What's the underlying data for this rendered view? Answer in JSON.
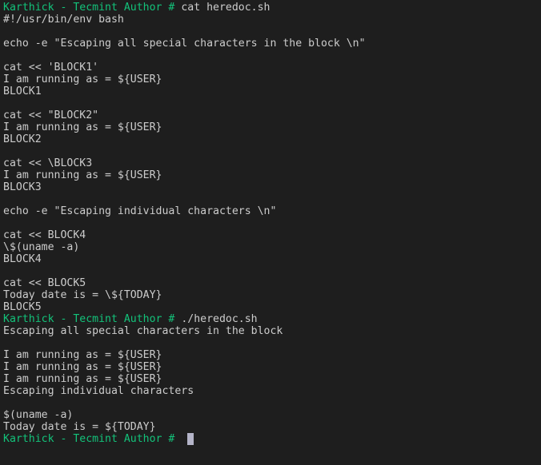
{
  "terminal": {
    "prompt": "Karthick - Tecmint Author #",
    "colors": {
      "background": "#1e1e1e",
      "text": "#cccccc",
      "prompt": "#13c27a",
      "cursor": "#b4b4c8"
    },
    "session": [
      {
        "type": "prompt",
        "command": " cat heredoc.sh"
      },
      {
        "type": "output",
        "text": "#!/usr/bin/env bash"
      },
      {
        "type": "output",
        "text": ""
      },
      {
        "type": "output",
        "text": "echo -e \"Escaping all special characters in the block \\n\""
      },
      {
        "type": "output",
        "text": ""
      },
      {
        "type": "output",
        "text": "cat << 'BLOCK1'"
      },
      {
        "type": "output",
        "text": "I am running as = ${USER}"
      },
      {
        "type": "output",
        "text": "BLOCK1"
      },
      {
        "type": "output",
        "text": ""
      },
      {
        "type": "output",
        "text": "cat << \"BLOCK2\""
      },
      {
        "type": "output",
        "text": "I am running as = ${USER}"
      },
      {
        "type": "output",
        "text": "BLOCK2"
      },
      {
        "type": "output",
        "text": ""
      },
      {
        "type": "output",
        "text": "cat << \\BLOCK3"
      },
      {
        "type": "output",
        "text": "I am running as = ${USER}"
      },
      {
        "type": "output",
        "text": "BLOCK3"
      },
      {
        "type": "output",
        "text": ""
      },
      {
        "type": "output",
        "text": "echo -e \"Escaping individual characters \\n\""
      },
      {
        "type": "output",
        "text": ""
      },
      {
        "type": "output",
        "text": "cat << BLOCK4"
      },
      {
        "type": "output",
        "text": "\\$(uname -a)"
      },
      {
        "type": "output",
        "text": "BLOCK4"
      },
      {
        "type": "output",
        "text": ""
      },
      {
        "type": "output",
        "text": "cat << BLOCK5"
      },
      {
        "type": "output",
        "text": "Today date is = \\${TODAY}"
      },
      {
        "type": "output",
        "text": "BLOCK5"
      },
      {
        "type": "prompt",
        "command": " ./heredoc.sh"
      },
      {
        "type": "output",
        "text": "Escaping all special characters in the block"
      },
      {
        "type": "output",
        "text": ""
      },
      {
        "type": "output",
        "text": "I am running as = ${USER}"
      },
      {
        "type": "output",
        "text": "I am running as = ${USER}"
      },
      {
        "type": "output",
        "text": "I am running as = ${USER}"
      },
      {
        "type": "output",
        "text": "Escaping individual characters"
      },
      {
        "type": "output",
        "text": ""
      },
      {
        "type": "output",
        "text": "$(uname -a)"
      },
      {
        "type": "output",
        "text": "Today date is = ${TODAY}"
      },
      {
        "type": "prompt",
        "command": "  ",
        "cursor": true
      }
    ]
  }
}
